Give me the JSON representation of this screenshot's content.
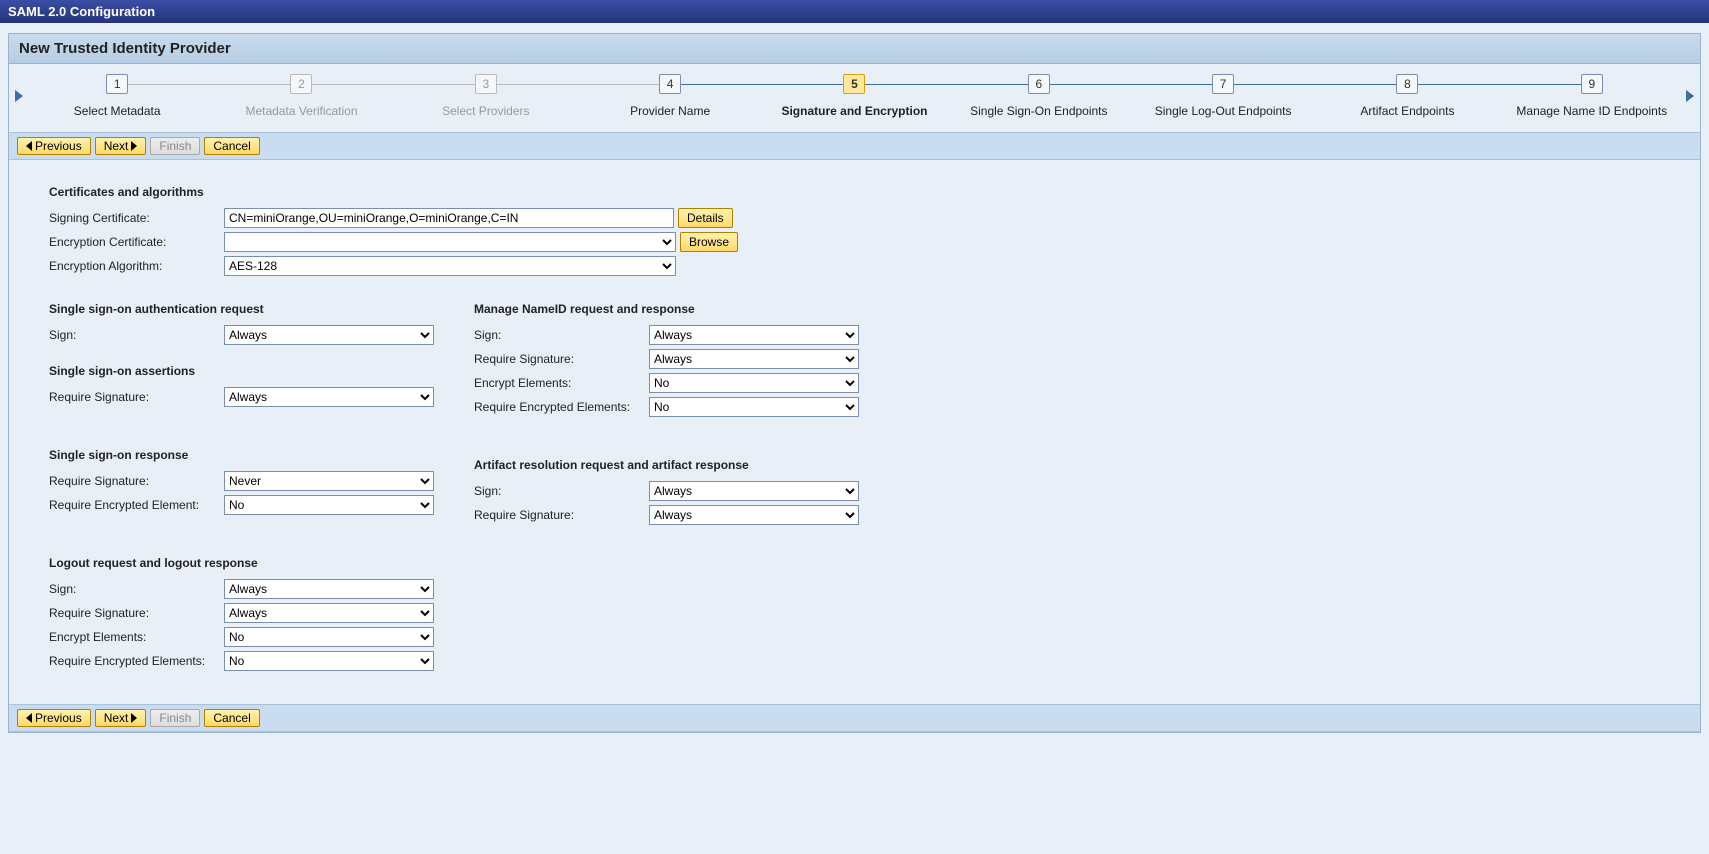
{
  "title": "SAML 2.0 Configuration",
  "panelTitle": "New Trusted Identity Provider",
  "steps": [
    {
      "n": "1",
      "label": "Select Metadata",
      "state": "normal"
    },
    {
      "n": "2",
      "label": "Metadata Verification",
      "state": "dim"
    },
    {
      "n": "3",
      "label": "Select Providers",
      "state": "dim"
    },
    {
      "n": "4",
      "label": "Provider Name",
      "state": "normal"
    },
    {
      "n": "5",
      "label": "Signature and Encryption",
      "state": "active"
    },
    {
      "n": "6",
      "label": "Single Sign-On Endpoints",
      "state": "normal"
    },
    {
      "n": "7",
      "label": "Single Log-Out Endpoints",
      "state": "normal"
    },
    {
      "n": "8",
      "label": "Artifact Endpoints",
      "state": "normal"
    },
    {
      "n": "9",
      "label": "Manage Name ID Endpoints",
      "state": "normal"
    }
  ],
  "buttons": {
    "previous": "Previous",
    "next": "Next",
    "finish": "Finish",
    "cancel": "Cancel"
  },
  "cert": {
    "sectionTitle": "Certificates and algorithms",
    "signingLabel": "Signing Certificate:",
    "signingValue": "CN=miniOrange,OU=miniOrange,O=miniOrange,C=IN",
    "details": "Details",
    "encCertLabel": "Encryption Certificate:",
    "encCertValue": "",
    "browse": "Browse",
    "encAlgLabel": "Encryption Algorithm:",
    "encAlgValue": "AES-128"
  },
  "ssoAuth": {
    "title": "Single sign-on authentication request",
    "signLabel": "Sign:",
    "signValue": "Always"
  },
  "ssoAssert": {
    "title": "Single sign-on assertions",
    "reqSigLabel": "Require Signature:",
    "reqSigValue": "Always"
  },
  "ssoResp": {
    "title": "Single sign-on response",
    "reqSigLabel": "Require Signature:",
    "reqSigValue": "Never",
    "reqEncLabel": "Require Encrypted Element:",
    "reqEncValue": "No"
  },
  "logout": {
    "title": "Logout request and logout response",
    "signLabel": "Sign:",
    "signValue": "Always",
    "reqSigLabel": "Require Signature:",
    "reqSigValue": "Always",
    "encLabel": "Encrypt Elements:",
    "encValue": "No",
    "reqEncLabel": "Require Encrypted Elements:",
    "reqEncValue": "No"
  },
  "nameid": {
    "title": "Manage NameID request and response",
    "signLabel": "Sign:",
    "signValue": "Always",
    "reqSigLabel": "Require Signature:",
    "reqSigValue": "Always",
    "encLabel": "Encrypt Elements:",
    "encValue": "No",
    "reqEncLabel": "Require Encrypted Elements:",
    "reqEncValue": "No"
  },
  "artifact": {
    "title": "Artifact resolution request and artifact response",
    "signLabel": "Sign:",
    "signValue": "Always",
    "reqSigLabel": "Require Signature:",
    "reqSigValue": "Always"
  }
}
